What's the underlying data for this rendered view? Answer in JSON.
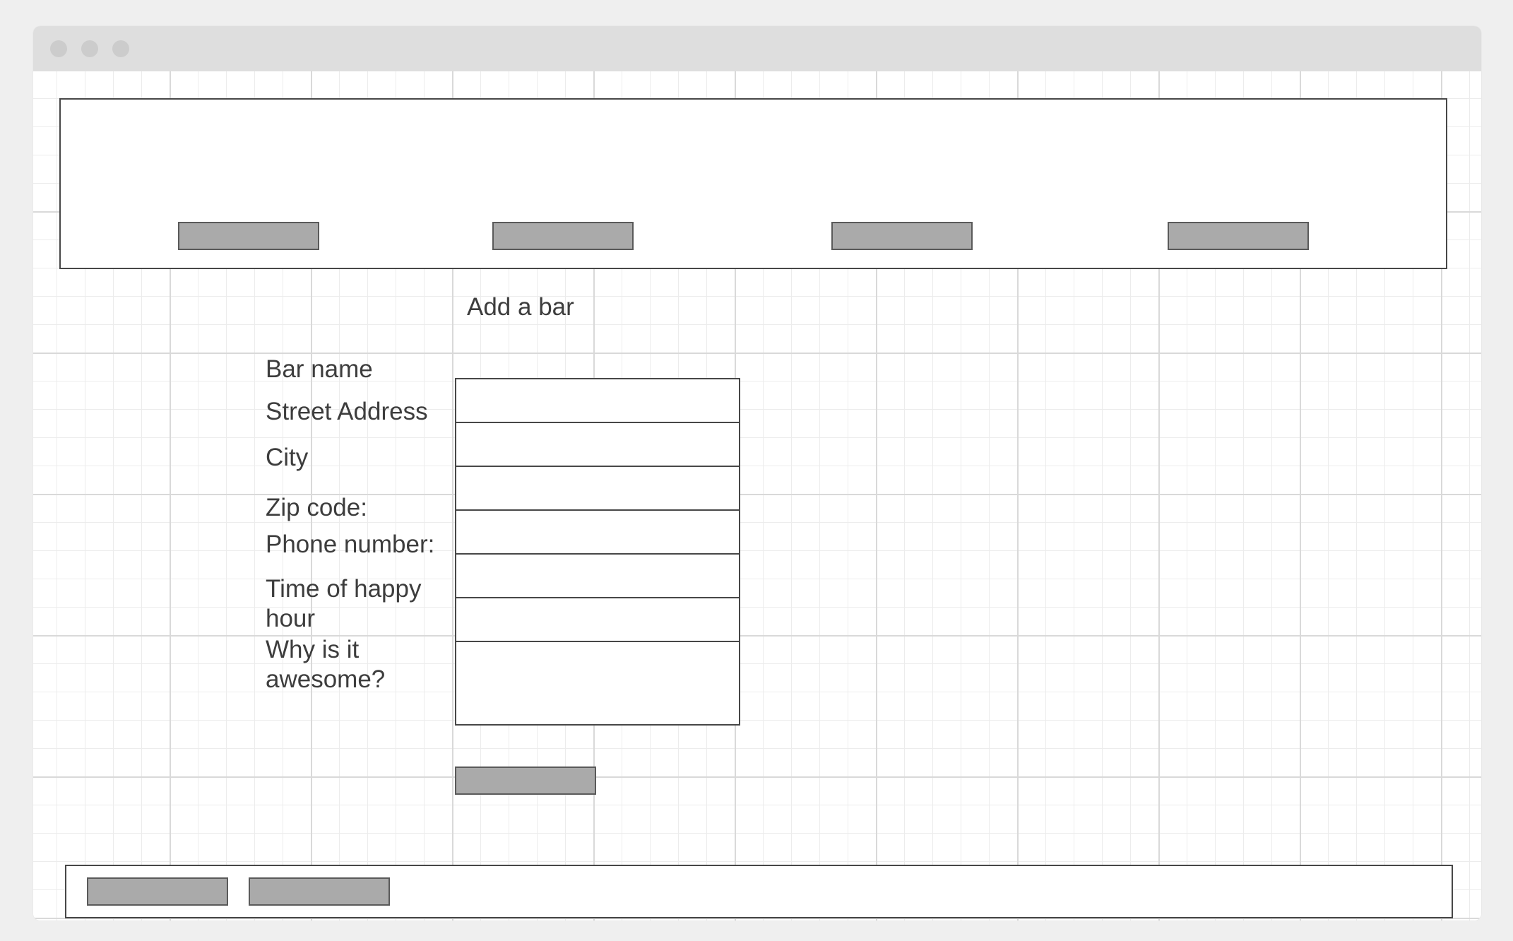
{
  "form": {
    "title": "Add a bar",
    "fields": [
      {
        "label": "Bar name",
        "value": ""
      },
      {
        "label": "Street Address",
        "value": ""
      },
      {
        "label": "City",
        "value": ""
      },
      {
        "label": "Zip code:",
        "value": ""
      },
      {
        "label": "Phone number:",
        "value": ""
      },
      {
        "label": "Time of happy hour",
        "value": ""
      },
      {
        "label": "Why is it awesome?",
        "value": ""
      }
    ],
    "submit_label": ""
  },
  "header": {
    "nav_buttons": [
      "",
      "",
      "",
      ""
    ]
  },
  "footer": {
    "buttons": [
      "",
      ""
    ]
  },
  "colors": {
    "button_fill": "#aaaaaa",
    "border": "#474747",
    "text": "#3d3d3d"
  }
}
